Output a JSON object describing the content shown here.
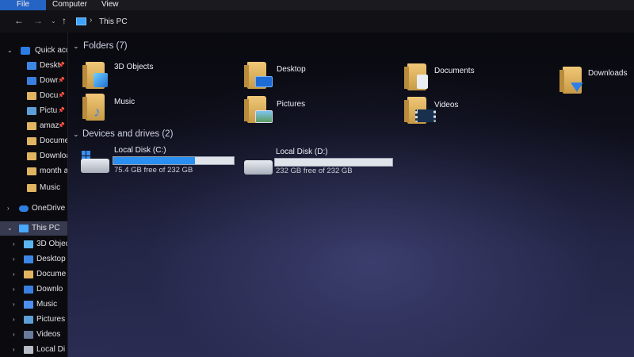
{
  "ribbon": {
    "tabs": [
      "File",
      "Computer",
      "View"
    ]
  },
  "address": {
    "location": "This PC",
    "separator": "›"
  },
  "nav_icons": {
    "back": "←",
    "forward": "→",
    "dropdown": "⌄",
    "up": "↑"
  },
  "navpane": {
    "items": [
      {
        "label": "Quick acce",
        "icon": "star-icon"
      },
      {
        "label": "Deskt",
        "icon": "desktop-icon"
      },
      {
        "label": "Dowr",
        "icon": "download-icon"
      },
      {
        "label": "Docu",
        "icon": "document-icon"
      },
      {
        "label": "Pictu",
        "icon": "picture-icon"
      },
      {
        "label": "amaz",
        "icon": "folder-icon"
      },
      {
        "label": "Docume",
        "icon": "folder-icon"
      },
      {
        "label": "Downloa",
        "icon": "folder-icon"
      },
      {
        "label": "month a",
        "icon": "folder-icon"
      },
      {
        "label": "Music",
        "icon": "folder-icon"
      },
      {
        "label": "OneDrive",
        "icon": "cloud-icon"
      },
      {
        "label": "This PC",
        "icon": "pc-icon"
      },
      {
        "label": "3D Objec",
        "icon": "cube-icon"
      },
      {
        "label": "Desktop",
        "icon": "desktop-icon"
      },
      {
        "label": "Docume",
        "icon": "document-icon"
      },
      {
        "label": "Downlo",
        "icon": "download-icon"
      },
      {
        "label": "Music",
        "icon": "music-icon"
      },
      {
        "label": "Pictures",
        "icon": "picture-icon"
      },
      {
        "label": "Videos",
        "icon": "video-icon"
      },
      {
        "label": "Local Di",
        "icon": "disk-icon"
      }
    ]
  },
  "folders": {
    "heading": "Folders (7)",
    "items": [
      {
        "label": "3D Objects",
        "icon": "3d-objects-folder-icon"
      },
      {
        "label": "Desktop",
        "icon": "desktop-folder-icon"
      },
      {
        "label": "Documents",
        "icon": "documents-folder-icon"
      },
      {
        "label": "Downloads",
        "icon": "downloads-folder-icon"
      },
      {
        "label": "Music",
        "icon": "music-folder-icon"
      },
      {
        "label": "Pictures",
        "icon": "pictures-folder-icon"
      },
      {
        "label": "Videos",
        "icon": "videos-folder-icon"
      }
    ]
  },
  "drives": {
    "heading": "Devices and drives (2)",
    "items": [
      {
        "name": "Local Disk (C:)",
        "free": "75.4 GB free of 232 GB",
        "used_fraction": 0.675
      },
      {
        "name": "Local Disk (D:)",
        "free": "232 GB free of 232 GB",
        "used_fraction": 0.0
      }
    ]
  },
  "colors": {
    "accent": "#2563c4",
    "bar_fill": "#2a8ff0",
    "folder": "#e0b461"
  }
}
